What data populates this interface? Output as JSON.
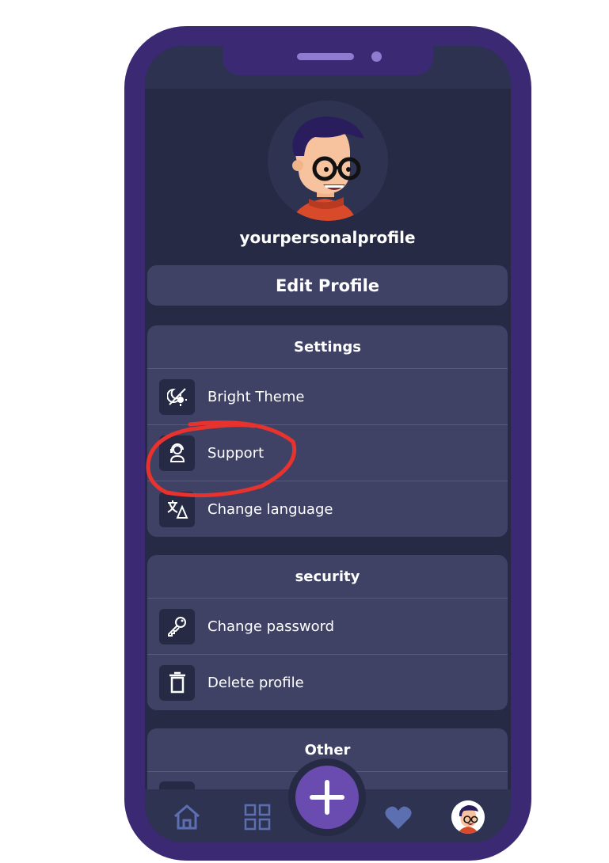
{
  "profile": {
    "username": "yourpersonalprofile",
    "edit_label": "Edit Profile"
  },
  "settings": {
    "title": "Settings",
    "items": [
      {
        "label": "Bright Theme",
        "icon": "theme-toggle-icon"
      },
      {
        "label": "Support",
        "icon": "support-agent-icon"
      },
      {
        "label": "Change language",
        "icon": "translate-icon"
      }
    ]
  },
  "security": {
    "title": "security",
    "items": [
      {
        "label": "Change password",
        "icon": "key-icon"
      },
      {
        "label": "Delete profile",
        "icon": "trash-icon"
      }
    ]
  },
  "other": {
    "title": "Other"
  },
  "nav": {
    "items": [
      "home-icon",
      "grid-icon",
      "add-icon",
      "heart-icon",
      "profile-avatar"
    ]
  },
  "colors": {
    "phone_frame": "#3b2a73",
    "background": "#262a44",
    "card": "#3f4265",
    "accent": "#6a4bb0",
    "annotation": "#e8322d"
  }
}
